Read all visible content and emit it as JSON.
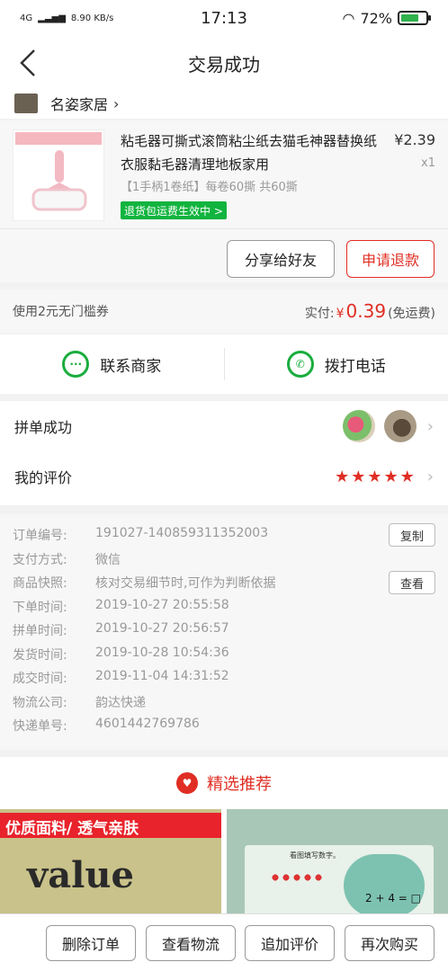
{
  "status_bar": {
    "network": "4G",
    "speed": "8.90 KB/s",
    "time": "17:13",
    "battery": "72%",
    "battery_level": 0.72
  },
  "header": {
    "title": "交易成功"
  },
  "shop": {
    "name": "名姿家居"
  },
  "product": {
    "title": "粘毛器可撕式滚筒粘尘纸去猫毛神器替换纸衣服黏毛器清理地板家用",
    "price": "¥2.39",
    "quantity": "x1",
    "spec": "【1手柄1卷纸】每卷60撕 共60撕",
    "badge": "退货包运费生效中 >"
  },
  "actions": {
    "share": "分享给好友",
    "refund": "申请退款"
  },
  "payment": {
    "coupon": "使用2元无门槛券",
    "paid_label": "实付:",
    "currency": "¥",
    "amount": "0.39",
    "shipping": "(免运费)"
  },
  "contact": {
    "merchant": "联系商家",
    "call": "拨打电话"
  },
  "group": {
    "label": "拼单成功"
  },
  "review": {
    "label": "我的评价",
    "stars": "★★★★★",
    "rating": 5
  },
  "order": {
    "rows": [
      {
        "label": "订单编号:",
        "value": "191027-140859311352003"
      },
      {
        "label": "支付方式:",
        "value": "微信"
      },
      {
        "label": "商品快照:",
        "value": "核对交易细节时,可作为判断依据"
      },
      {
        "label": "下单时间:",
        "value": "2019-10-27 20:55:58"
      },
      {
        "label": "拼单时间:",
        "value": "2019-10-27 20:56:57"
      },
      {
        "label": "发货时间:",
        "value": "2019-10-28 10:54:36"
      },
      {
        "label": "成交时间:",
        "value": "2019-11-04 14:31:52"
      },
      {
        "label": "物流公司:",
        "value": "韵达快递"
      },
      {
        "label": "快递单号:",
        "value": "4601442769786"
      }
    ],
    "copy": "复制",
    "view": "查看"
  },
  "recommend": {
    "title": "精选推荐",
    "item1_banner": "优质面料/ 透气亲肤",
    "item1_word": "value",
    "item2_caption": "看图填写数字。",
    "item2_eq": "2 + 4 = □"
  },
  "bottom": {
    "delete": "删除订单",
    "logistics": "查看物流",
    "add_review": "追加评价",
    "rebuy": "再次购买"
  },
  "colors": {
    "accent": "#e02e24",
    "green": "#1aad3f"
  }
}
